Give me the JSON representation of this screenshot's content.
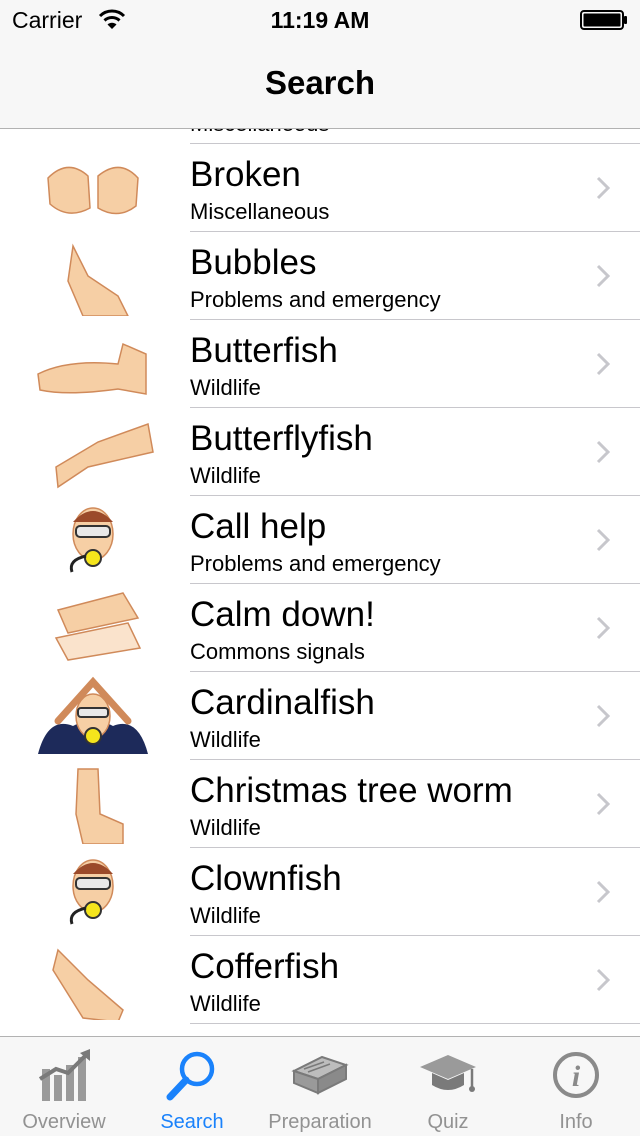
{
  "status_bar": {
    "carrier": "Carrier",
    "time": "11:19 AM"
  },
  "nav": {
    "title": "Search"
  },
  "list": {
    "items": [
      {
        "title": "",
        "subtitle": "Miscellaneous",
        "icon": "hand-signal-image"
      },
      {
        "title": "Broken",
        "subtitle": "Miscellaneous",
        "icon": "broken-sign-image"
      },
      {
        "title": "Bubbles",
        "subtitle": "Problems and emergency",
        "icon": "bubbles-sign-image"
      },
      {
        "title": "Butterfish",
        "subtitle": "Wildlife",
        "icon": "butterfish-sign-image"
      },
      {
        "title": "Butterflyfish",
        "subtitle": "Wildlife",
        "icon": "butterflyfish-sign-image"
      },
      {
        "title": "Call help",
        "subtitle": "Problems and emergency",
        "icon": "call-help-diver-image"
      },
      {
        "title": "Calm down!",
        "subtitle": "Commons signals",
        "icon": "calm-down-sign-image"
      },
      {
        "title": "Cardinalfish",
        "subtitle": "Wildlife",
        "icon": "cardinalfish-diver-image"
      },
      {
        "title": "Christmas tree worm",
        "subtitle": "Wildlife",
        "icon": "christmas-tree-worm-sign-image"
      },
      {
        "title": "Clownfish",
        "subtitle": "Wildlife",
        "icon": "clownfish-diver-image"
      },
      {
        "title": "Cofferfish",
        "subtitle": "Wildlife",
        "icon": "cofferfish-sign-image"
      },
      {
        "title": "",
        "subtitle": "",
        "icon": "hand-signal-image"
      }
    ]
  },
  "tabs": [
    {
      "label": "Overview",
      "icon": "chart-icon",
      "active": false
    },
    {
      "label": "Search",
      "icon": "search-icon",
      "active": true
    },
    {
      "label": "Preparation",
      "icon": "book-icon",
      "active": false
    },
    {
      "label": "Quiz",
      "icon": "graduation-cap-icon",
      "active": false
    },
    {
      "label": "Info",
      "icon": "info-icon",
      "active": false
    }
  ],
  "colors": {
    "accent": "#1a82fb",
    "tab_inactive": "#929292",
    "bar_bg": "#f7f7f7",
    "skin": "#f6cfa5",
    "skin_outline": "#d08a5a"
  }
}
